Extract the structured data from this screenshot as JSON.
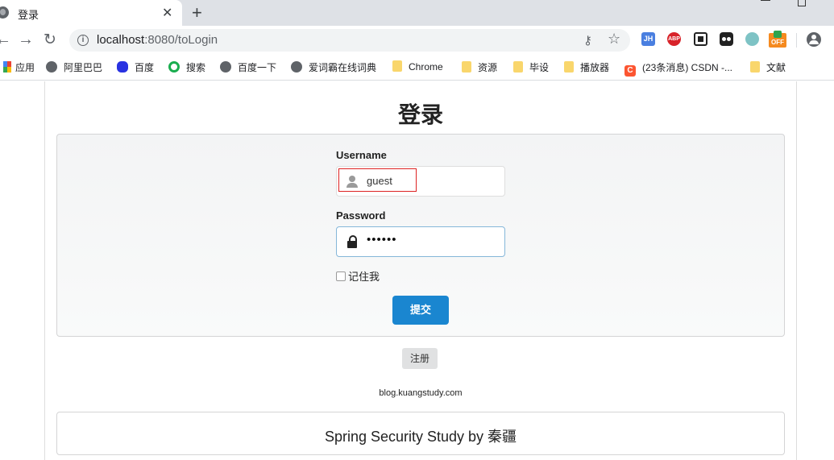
{
  "browser": {
    "tab_title": "登录",
    "tab_close": "✕",
    "new_tab": "+",
    "url_host": "localhost",
    "url_rest": ":8080/toLogin",
    "extensions": [
      "JH",
      "ABP",
      "OFF"
    ]
  },
  "bookmarks": [
    {
      "label": "应用",
      "icon": "apps-icon"
    },
    {
      "label": "阿里巴巴",
      "icon": "globe-icon"
    },
    {
      "label": "百度",
      "icon": "baidu-icon"
    },
    {
      "label": "搜索",
      "icon": "search-icon"
    },
    {
      "label": "百度一下",
      "icon": "globe-icon"
    },
    {
      "label": "爱词霸在线词典",
      "icon": "globe-icon"
    },
    {
      "label": "Chrome",
      "icon": "folder-icon"
    },
    {
      "label": "资源",
      "icon": "folder-icon"
    },
    {
      "label": "毕设",
      "icon": "folder-icon"
    },
    {
      "label": "播放器",
      "icon": "folder-icon"
    },
    {
      "label": "(23条消息) CSDN -...",
      "icon": "csdn-icon"
    },
    {
      "label": "文献",
      "icon": "folder-icon"
    }
  ],
  "page": {
    "title": "登录",
    "username_label": "Username",
    "username_value": "guest",
    "password_label": "Password",
    "password_value": "••••••",
    "remember_label": "记住我",
    "submit_label": "提交",
    "register_label": "注册",
    "footer_link": "blog.kuangstudy.com",
    "footer_title": "Spring Security Study by 秦疆"
  }
}
